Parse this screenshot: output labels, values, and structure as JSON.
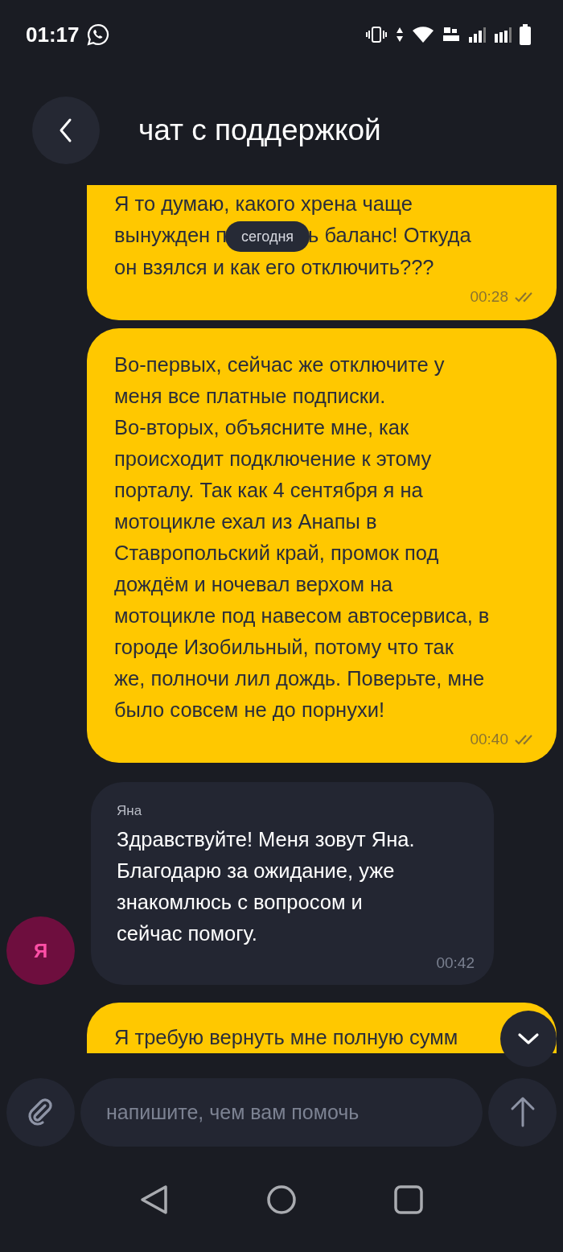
{
  "status_bar": {
    "time": "01:17"
  },
  "header": {
    "title": "чат с поддержкой"
  },
  "date_pill": "сегодня",
  "messages": [
    {
      "kind": "outgoing",
      "lines": [
        [
          "Я то думаю, какого хрена чаще"
        ],
        [
          "вынужден п",
          "ь баланс! Откуда"
        ],
        [
          "он взялся и как его отключить???"
        ]
      ],
      "time": "00:28",
      "read": true
    },
    {
      "kind": "outgoing",
      "parts": [
        "Во-первых, сейчас же отключите у\nменя все платные подписки.\nВо-вторых, объясните мне, как\nпроисходит подключение к этому\nпорталу. Так как 4 сентября я на\nмотоцикле ехал из Анапы в\nСтавропольский край, промок под\nдождём и ночевал верхом на\nмотоцикле под навесом автосервиса, в\nгороде Изобильный, потому что так\nже, полночи лил дождь. Поверьте, мне\nбыло совсем не до порнухи!"
      ],
      "time": "00:40",
      "read": true
    },
    {
      "kind": "incoming",
      "sender": "Яна",
      "avatar": "Я",
      "parts": [
        "Здравствуйте! Меня зовут Яна.\nБлагодарю за ожидание, уже\nзнакомлюсь с вопросом и\nсейчас помогу."
      ],
      "time": "00:42"
    },
    {
      "kind": "outgoing",
      "parts": [
        "Я требую вернуть мне полную сумм"
      ]
    }
  ],
  "composer": {
    "placeholder": "напишите, чем вам помочь"
  }
}
